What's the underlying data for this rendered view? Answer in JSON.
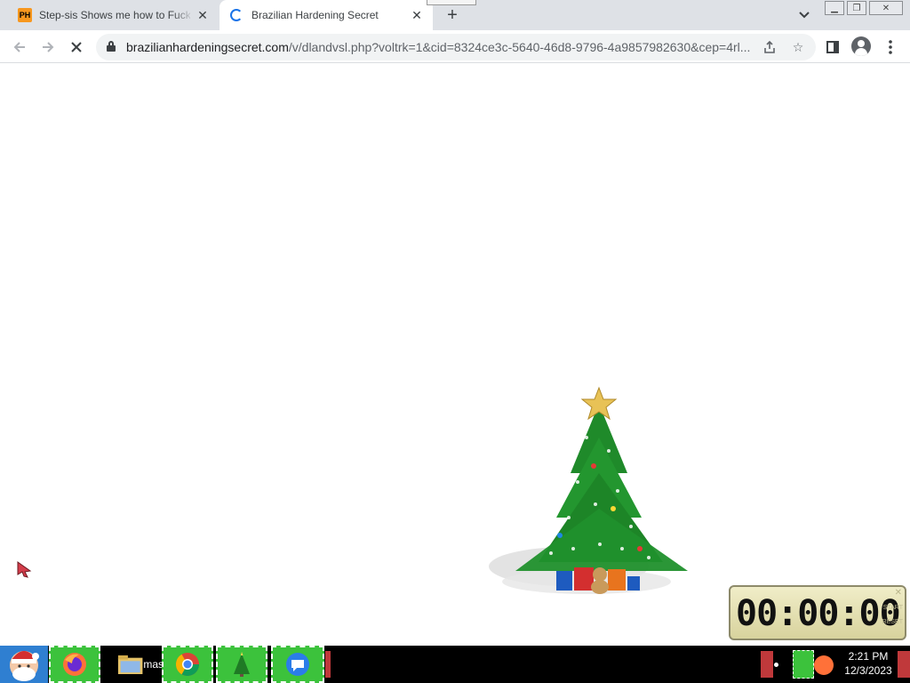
{
  "browser": {
    "tabs": [
      {
        "title": "Step-sis Shows me how to Fuck ·",
        "favicon": "PH",
        "active": false
      },
      {
        "title": "Brazilian Hardening Secret",
        "favicon": "loading-spinner",
        "active": true
      }
    ],
    "address": {
      "url_domain": "brazilianhardeningsecret.com",
      "url_path": "/v/dlandvsl.php?voltrk=1&cid=8324ce3c-5640-46d8-9796-4a9857982630&cep=4rl..."
    },
    "icons": [
      "back-arrow-icon",
      "forward-arrow-icon",
      "stop-loading-icon",
      "lock-icon",
      "share-icon",
      "star-icon",
      "side-panel-icon",
      "profile-icon",
      "kebab-menu-icon"
    ]
  },
  "clock_widget": {
    "display": "00:00:00",
    "side_labels": [
      "START",
      "RESET"
    ]
  },
  "taskbar": {
    "partial_label": "mas",
    "time": "2:21 PM",
    "date": "12/3/2023"
  },
  "colors": {
    "tabstrip": "#dee1e6",
    "accent": "#1a73e8",
    "taskbar": "#000000",
    "taskbar_green": "#3cc23c",
    "tray_red": "#c0393b"
  }
}
